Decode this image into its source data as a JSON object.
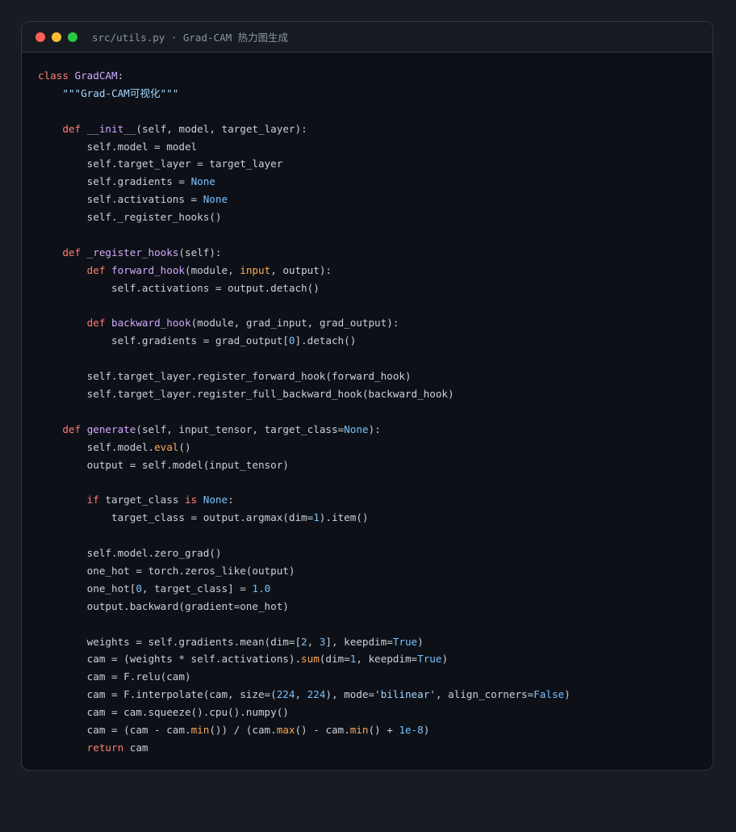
{
  "window": {
    "title": "src/utils.py · Grad-CAM 热力图生成"
  },
  "editor": {
    "language": "python",
    "lines": [
      [
        [
          "kw",
          "class"
        ],
        [
          "t",
          " "
        ],
        [
          "fn",
          "GradCAM"
        ],
        [
          "t",
          ":"
        ]
      ],
      [
        [
          "t",
          "    "
        ],
        [
          "str",
          "\"\"\"Grad-CAM可视化\"\"\""
        ]
      ],
      [],
      [
        [
          "t",
          "    "
        ],
        [
          "kw",
          "def"
        ],
        [
          "t",
          " "
        ],
        [
          "fn",
          "__init__"
        ],
        [
          "t",
          "(self, model, target_layer):"
        ]
      ],
      [
        [
          "t",
          "        self.model = model"
        ]
      ],
      [
        [
          "t",
          "        self.target_layer = target_layer"
        ]
      ],
      [
        [
          "t",
          "        self.gradients = "
        ],
        [
          "const",
          "None"
        ]
      ],
      [
        [
          "t",
          "        self.activations = "
        ],
        [
          "const",
          "None"
        ]
      ],
      [
        [
          "t",
          "        self._register_hooks()"
        ]
      ],
      [],
      [
        [
          "t",
          "    "
        ],
        [
          "kw",
          "def"
        ],
        [
          "t",
          " "
        ],
        [
          "fn",
          "_register_hooks"
        ],
        [
          "t",
          "(self):"
        ]
      ],
      [
        [
          "t",
          "        "
        ],
        [
          "kw",
          "def"
        ],
        [
          "t",
          " "
        ],
        [
          "fn",
          "forward_hook"
        ],
        [
          "t",
          "(module, "
        ],
        [
          "bi",
          "input"
        ],
        [
          "t",
          ", output):"
        ]
      ],
      [
        [
          "t",
          "            self.activations = output.detach()"
        ]
      ],
      [],
      [
        [
          "t",
          "        "
        ],
        [
          "kw",
          "def"
        ],
        [
          "t",
          " "
        ],
        [
          "fn",
          "backward_hook"
        ],
        [
          "t",
          "(module, grad_input, grad_output):"
        ]
      ],
      [
        [
          "t",
          "            self.gradients = grad_output["
        ],
        [
          "num",
          "0"
        ],
        [
          "t",
          "].detach()"
        ]
      ],
      [],
      [
        [
          "t",
          "        self.target_layer.register_forward_hook(forward_hook)"
        ]
      ],
      [
        [
          "t",
          "        self.target_layer.register_full_backward_hook(backward_hook)"
        ]
      ],
      [],
      [
        [
          "t",
          "    "
        ],
        [
          "kw",
          "def"
        ],
        [
          "t",
          " "
        ],
        [
          "fn",
          "generate"
        ],
        [
          "t",
          "(self, input_tensor, target_class="
        ],
        [
          "const",
          "None"
        ],
        [
          "t",
          "):"
        ]
      ],
      [
        [
          "t",
          "        self.model."
        ],
        [
          "bi",
          "eval"
        ],
        [
          "t",
          "()"
        ]
      ],
      [
        [
          "t",
          "        output = self.model(input_tensor)"
        ]
      ],
      [],
      [
        [
          "t",
          "        "
        ],
        [
          "kw",
          "if"
        ],
        [
          "t",
          " target_class "
        ],
        [
          "kw",
          "is"
        ],
        [
          "t",
          " "
        ],
        [
          "const",
          "None"
        ],
        [
          "t",
          ":"
        ]
      ],
      [
        [
          "t",
          "            target_class = output.argmax(dim="
        ],
        [
          "num",
          "1"
        ],
        [
          "t",
          ").item()"
        ]
      ],
      [],
      [
        [
          "t",
          "        self.model.zero_grad()"
        ]
      ],
      [
        [
          "t",
          "        one_hot = torch.zeros_like(output)"
        ]
      ],
      [
        [
          "t",
          "        one_hot["
        ],
        [
          "num",
          "0"
        ],
        [
          "t",
          ", target_class] = "
        ],
        [
          "num",
          "1.0"
        ]
      ],
      [
        [
          "t",
          "        output.backward(gradient=one_hot)"
        ]
      ],
      [],
      [
        [
          "t",
          "        weights = self.gradients.mean(dim=["
        ],
        [
          "num",
          "2"
        ],
        [
          "t",
          ", "
        ],
        [
          "num",
          "3"
        ],
        [
          "t",
          "], keepdim="
        ],
        [
          "const",
          "True"
        ],
        [
          "t",
          ")"
        ]
      ],
      [
        [
          "t",
          "        cam = (weights * self.activations)."
        ],
        [
          "bi",
          "sum"
        ],
        [
          "t",
          "(dim="
        ],
        [
          "num",
          "1"
        ],
        [
          "t",
          ", keepdim="
        ],
        [
          "const",
          "True"
        ],
        [
          "t",
          ")"
        ]
      ],
      [
        [
          "t",
          "        cam = F.relu(cam)"
        ]
      ],
      [
        [
          "t",
          "        cam = F.interpolate(cam, size=("
        ],
        [
          "num",
          "224"
        ],
        [
          "t",
          ", "
        ],
        [
          "num",
          "224"
        ],
        [
          "t",
          "), mode="
        ],
        [
          "str",
          "'bilinear'"
        ],
        [
          "t",
          ", align_corners="
        ],
        [
          "const",
          "False"
        ],
        [
          "t",
          ")"
        ]
      ],
      [
        [
          "t",
          "        cam = cam.squeeze().cpu().numpy()"
        ]
      ],
      [
        [
          "t",
          "        cam = (cam - cam."
        ],
        [
          "bi",
          "min"
        ],
        [
          "t",
          "()) / (cam."
        ],
        [
          "bi",
          "max"
        ],
        [
          "t",
          "() - cam."
        ],
        [
          "bi",
          "min"
        ],
        [
          "t",
          "() + "
        ],
        [
          "num",
          "1e-8"
        ],
        [
          "t",
          ")"
        ]
      ],
      [
        [
          "t",
          "        "
        ],
        [
          "kw",
          "return"
        ],
        [
          "t",
          " cam"
        ]
      ]
    ]
  },
  "colors": {
    "keyword": "#ff7b72",
    "function": "#d2a8ff",
    "string": "#a5d6ff",
    "number": "#79c0ff",
    "builtin": "#ffa657",
    "text": "#c9d1d9",
    "background": "#0d1117"
  }
}
